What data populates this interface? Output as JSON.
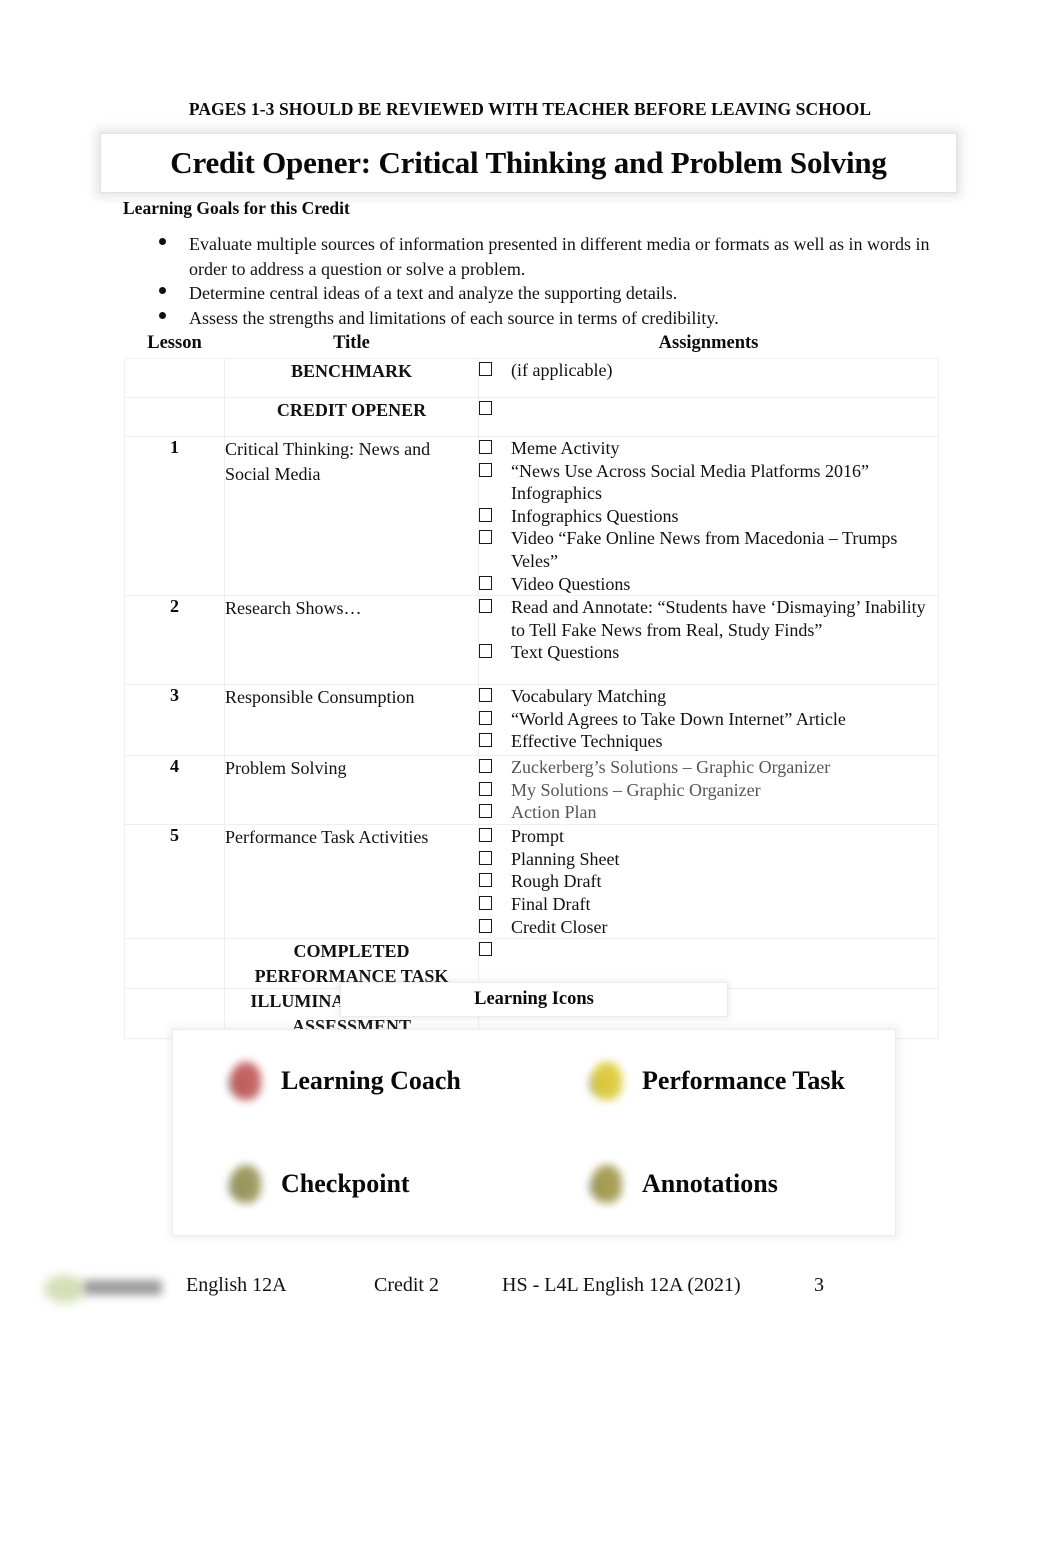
{
  "header": {
    "notice": "PAGES 1-3 SHOULD BE REVIEWED WITH TEACHER BEFORE LEAVING SCHOOL",
    "title": "Credit Opener: Critical Thinking and Problem Solving"
  },
  "learning_goals": {
    "heading": "Learning Goals for this Credit",
    "items": [
      "Evaluate multiple sources of information presented in different media or formats as well as in words in order to address a question or solve a problem.",
      "Determine central ideas of a text and analyze the supporting details.",
      "Assess the strengths and limitations of each source in terms of credibility."
    ]
  },
  "table": {
    "columns": [
      "Lesson",
      "Title",
      "Assignments"
    ],
    "rows": [
      {
        "lesson": "",
        "title": "BENCHMARK",
        "title_style": "center-bold",
        "assignments": [
          "(if applicable)"
        ]
      },
      {
        "lesson": "",
        "title": "CREDIT OPENER",
        "title_style": "center-bold",
        "assignments": [
          ""
        ]
      },
      {
        "lesson": "1",
        "title": "Critical Thinking: News and Social Media",
        "title_style": "normal",
        "assignments": [
          "Meme Activity",
          "“News Use Across Social Media Platforms 2016” Infographics",
          "Infographics Questions",
          "Video “Fake Online News from Macedonia – Trumps Veles”",
          "Video Questions"
        ]
      },
      {
        "lesson": "2",
        "title": "Research Shows…",
        "title_style": "normal",
        "assignments": [
          "Read and Annotate: “Students have ‘Dismaying’ Inability to Tell Fake News from Real, Study Finds”",
          "Text Questions"
        ]
      },
      {
        "lesson": "3",
        "title": "Responsible Consumption",
        "title_style": "normal",
        "assignments": [
          "Vocabulary Matching",
          "“World Agrees to Take Down Internet” Article",
          "Effective Techniques"
        ]
      },
      {
        "lesson": "4",
        "title": "Problem Solving",
        "title_style": "normal",
        "dim": true,
        "assignments": [
          "Zuckerberg’s Solutions – Graphic Organizer",
          "My Solutions – Graphic Organizer",
          "Action Plan"
        ]
      },
      {
        "lesson": "5",
        "title": "Performance Task Activities",
        "title_style": "normal",
        "assignments": [
          "Prompt",
          "Planning Sheet",
          "Rough Draft",
          "Final Draft",
          "Credit Closer"
        ]
      },
      {
        "lesson": "",
        "title": "COMPLETED PERFORMANCE TASK",
        "title_style": "center-bold",
        "assignments": [
          ""
        ]
      },
      {
        "lesson": "",
        "title": "ILLUMINATE MODULE ASSESSMENT",
        "title_style": "center-bold",
        "assignments": [
          ""
        ]
      }
    ]
  },
  "learning_icons": {
    "heading": "Learning Icons",
    "items": [
      {
        "label": "Learning Coach",
        "icon": "learning-coach-icon",
        "color": "#b94a4a"
      },
      {
        "label": "Performance Task",
        "icon": "performance-task-icon",
        "color": "#d8c524"
      },
      {
        "label": "Checkpoint",
        "icon": "checkpoint-icon",
        "color": "#8d8a4a"
      },
      {
        "label": "Annotations",
        "icon": "annotations-icon",
        "color": "#9a8f3c"
      }
    ]
  },
  "footer": {
    "course": "English 12A",
    "credit": "Credit 2",
    "module": "HS - L4L English 12A (2021)",
    "page": "3"
  }
}
